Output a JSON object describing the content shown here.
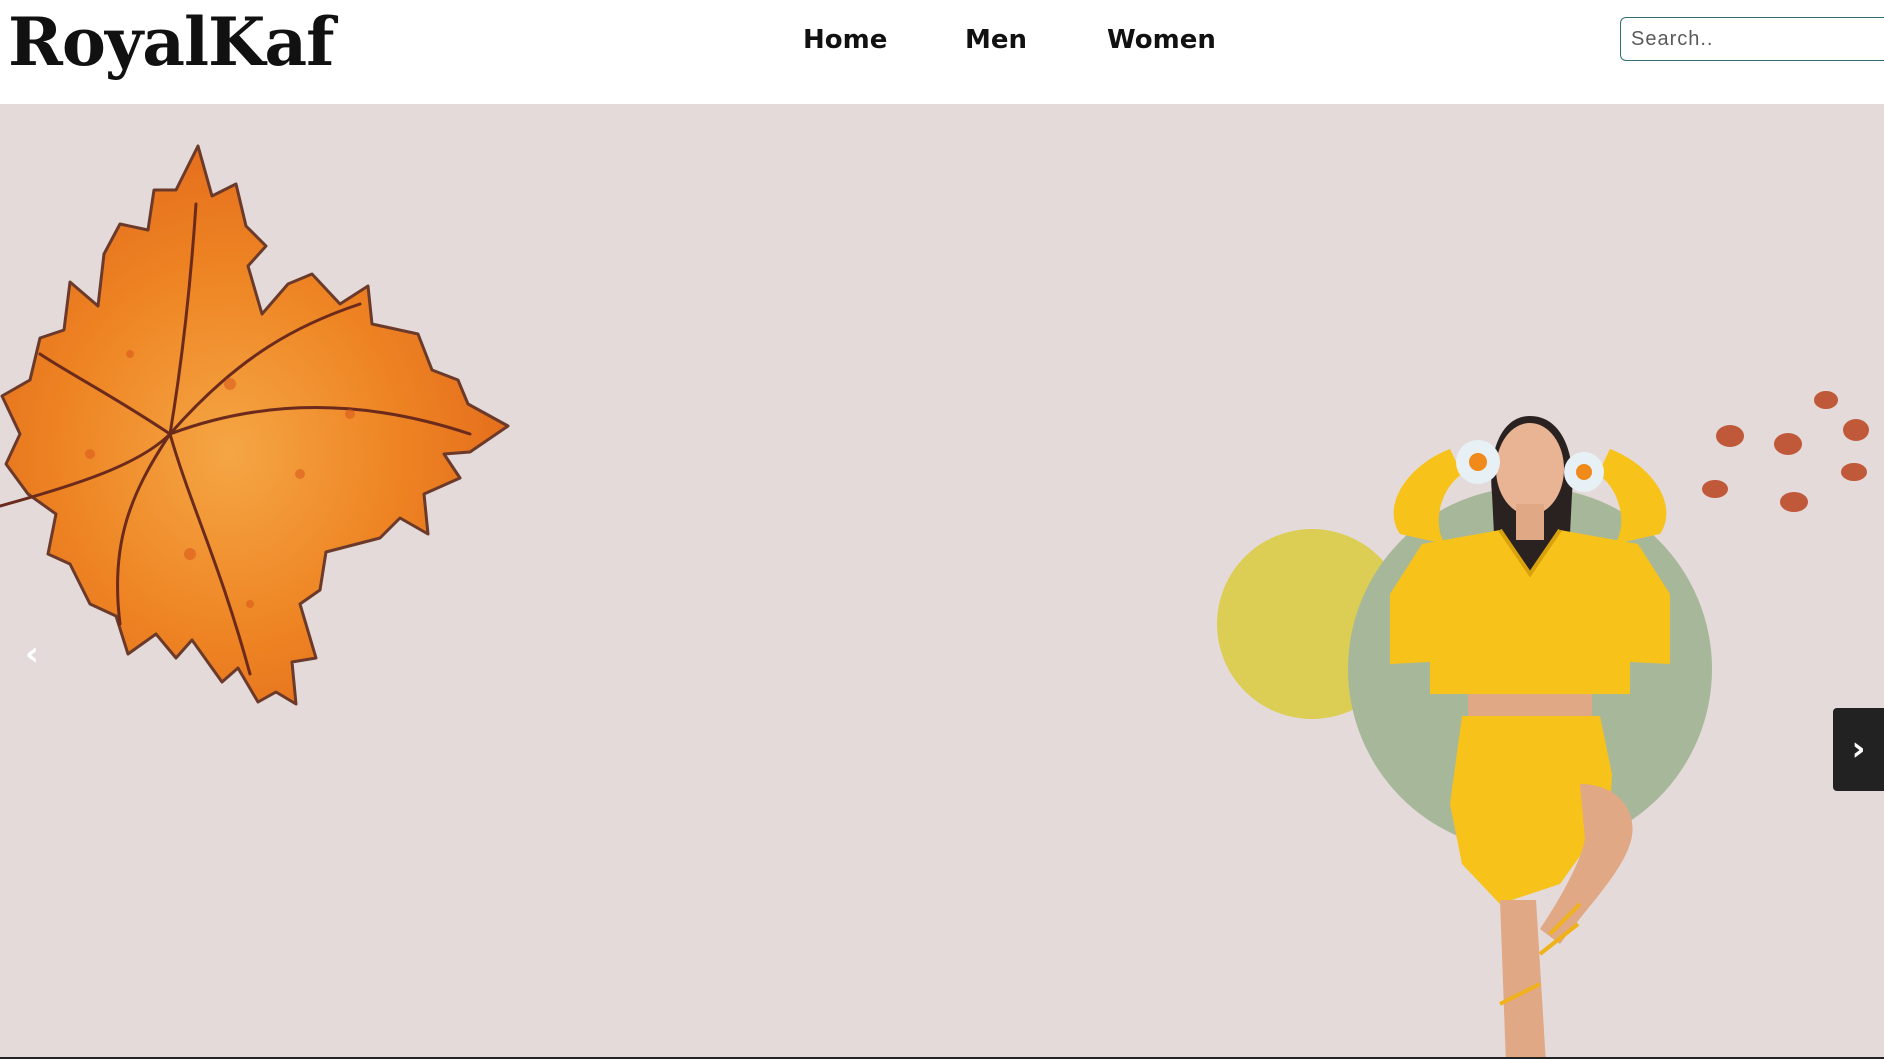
{
  "brand": {
    "logo_text": "RoyalKaf"
  },
  "nav": {
    "items": [
      {
        "label": "Home"
      },
      {
        "label": "Men"
      },
      {
        "label": "Women"
      }
    ]
  },
  "search": {
    "placeholder": "Search.."
  },
  "carousel": {
    "prev_label": "‹",
    "next_label": "›"
  },
  "colors": {
    "hero_background": "#e4dad9",
    "leaf_orange": "#f08a2a",
    "outfit_yellow": "#f7c21a",
    "yellow_circle": "#dccd55",
    "green_circle": "#a7b79a",
    "dots": "#c0583a",
    "search_border": "#2f6f73"
  }
}
